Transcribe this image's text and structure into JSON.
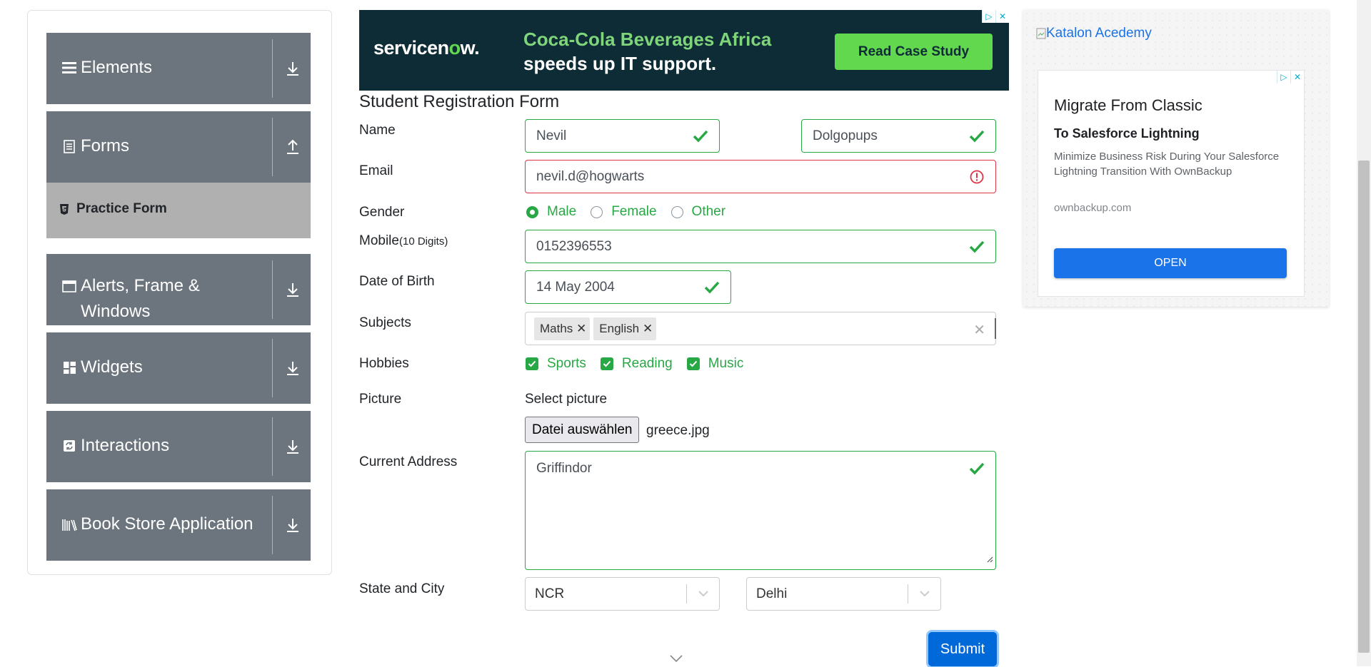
{
  "sidebar": {
    "groups": [
      {
        "label": "Elements",
        "icon": "list-icon",
        "arrow": "download-arrow-icon"
      },
      {
        "label": "Forms",
        "icon": "document-icon",
        "arrow": "upload-arrow-icon"
      },
      {
        "label": "Alerts, Frame &",
        "label2": "Windows",
        "icon": "window-icon",
        "arrow": "download-arrow-icon"
      },
      {
        "label": "Widgets",
        "icon": "widgets-icon",
        "arrow": "download-arrow-icon"
      },
      {
        "label": "Interactions",
        "icon": "interactions-icon",
        "arrow": "download-arrow-icon"
      },
      {
        "label": "Book Store Application",
        "icon": "books-icon",
        "arrow": "download-arrow-icon"
      }
    ],
    "active_item": "Practice Form"
  },
  "banner": {
    "brand_prefix": "servicen",
    "brand_o": "o",
    "brand_suffix": "w.",
    "headline_1": "Coca-Cola Beverages Africa",
    "headline_2": "speeds up IT support.",
    "cta": "Read Case Study"
  },
  "form": {
    "title": "Student Registration Form",
    "labels": {
      "name": "Name",
      "email": "Email",
      "gender": "Gender",
      "mobile": "Mobile",
      "mobile_hint": "(10 Digits)",
      "dob": "Date of Birth",
      "subjects": "Subjects",
      "hobbies": "Hobbies",
      "picture": "Picture",
      "address": "Current Address",
      "state_city": "State and City"
    },
    "first_name": "Nevil",
    "last_name": "Dolgopups",
    "email": "nevil.d@hogwarts",
    "gender_options": [
      "Male",
      "Female",
      "Other"
    ],
    "gender_selected": "Male",
    "mobile": "0152396553",
    "dob": "14 May 2004",
    "subjects": [
      "Maths",
      "English"
    ],
    "hobbies": [
      "Sports",
      "Reading",
      "Music"
    ],
    "picture_label": "Select picture",
    "file_button": "Datei auswählen",
    "file_name": "greece.jpg",
    "address": "Griffindor",
    "state": "NCR",
    "city": "Delhi",
    "submit": "Submit"
  },
  "right_ad": {
    "broken_image_alt": "Katalon Acedemy",
    "title": "Migrate From Classic",
    "subtitle": "To Salesforce Lightning",
    "body": "Minimize Business Risk During Your Salesforce Lightning Transition With OwnBackup",
    "domain": "ownbackup.com",
    "cta": "OPEN"
  },
  "colors": {
    "sidebar_group": "#6c757d",
    "active_item": "#b0b0b0",
    "valid": "#28a745",
    "invalid": "#dc3545",
    "primary": "#0069d9"
  }
}
